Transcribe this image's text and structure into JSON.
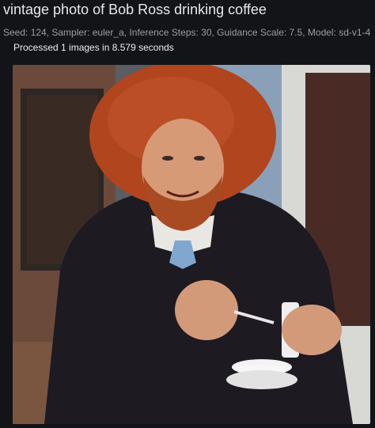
{
  "header": {
    "title": "vintage photo of Bob Ross drinking coffee",
    "meta": "Seed: 124, Sampler: euler_a, Inference Steps: 30, Guidance Scale: 7.5, Model: sd-v1-4",
    "status": "Processed 1 images in 8.579 seconds"
  },
  "colors": {
    "background": "#121417",
    "title_text": "#e8e8ea",
    "meta_text": "#9a9ea6"
  },
  "image": {
    "subject": "man with large red afro and beard, dark sweater, blue tie, holding white cup and saucer"
  }
}
